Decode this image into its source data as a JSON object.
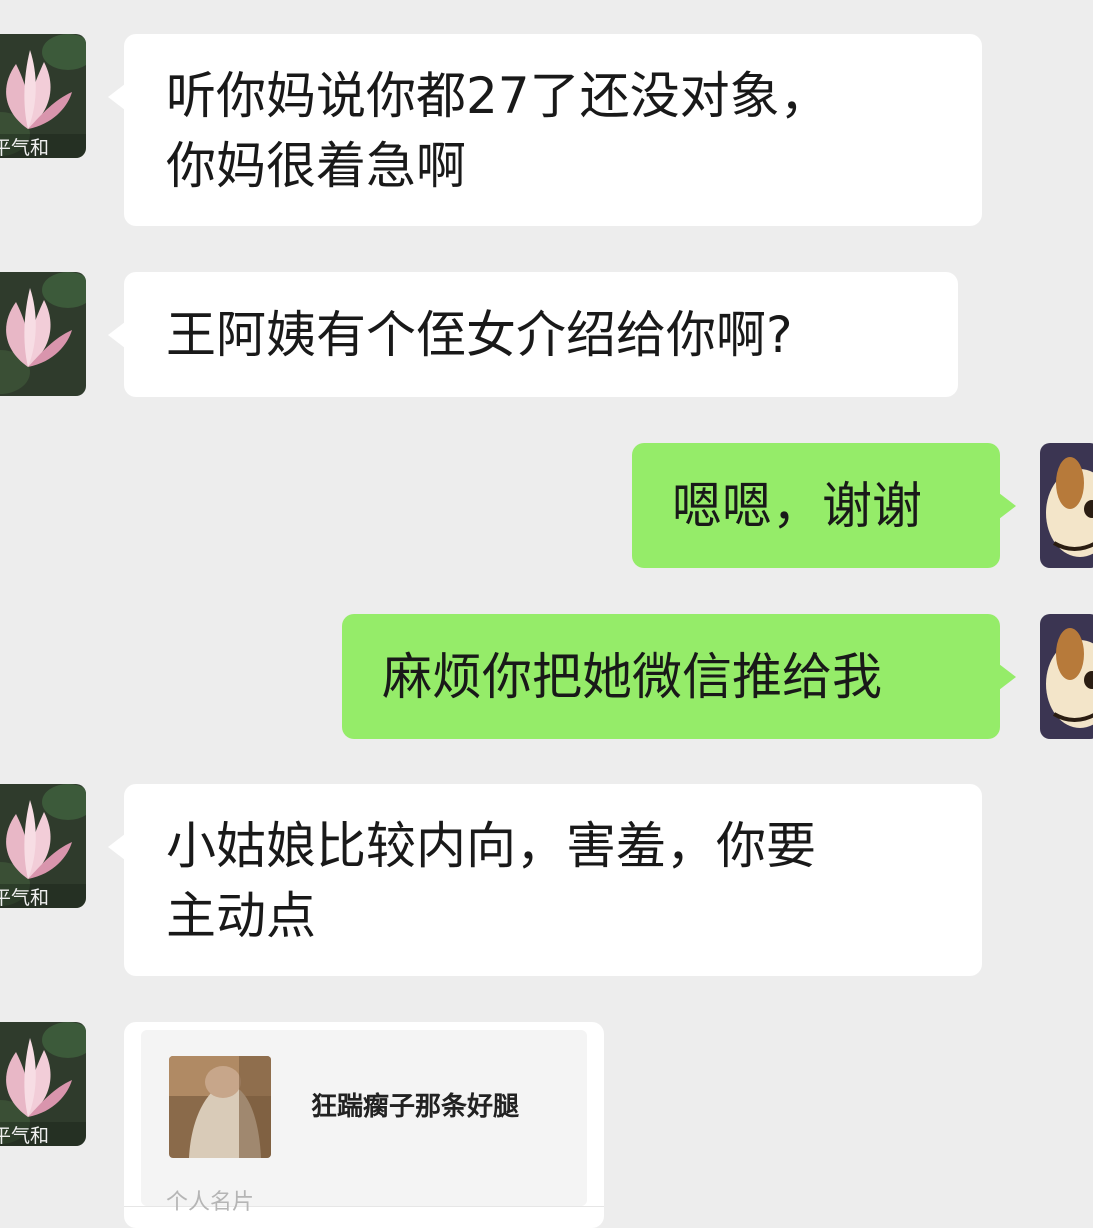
{
  "contact": {
    "avatar_caption": "平气和"
  },
  "messages": [
    {
      "side": "in",
      "text": "听你妈说你都27了还没对象，\n你妈很着急啊"
    },
    {
      "side": "in",
      "text": "王阿姨有个侄女介绍给你啊?"
    },
    {
      "side": "out",
      "text": "嗯嗯，谢谢"
    },
    {
      "side": "out",
      "text": "麻烦你把她微信推给我"
    },
    {
      "side": "in",
      "text": "小姑娘比较内向，害羞，你要\n主动点"
    }
  ],
  "contact_card": {
    "name": "狂踹瘸子那条好腿",
    "label": "个人名片"
  },
  "colors": {
    "background": "#ededed",
    "incoming_bubble": "#ffffff",
    "outgoing_bubble": "#95ec69"
  },
  "icons": {
    "incoming_avatar": "lotus-avatar-icon",
    "outgoing_avatar": "cartoon-dog-avatar-icon"
  }
}
